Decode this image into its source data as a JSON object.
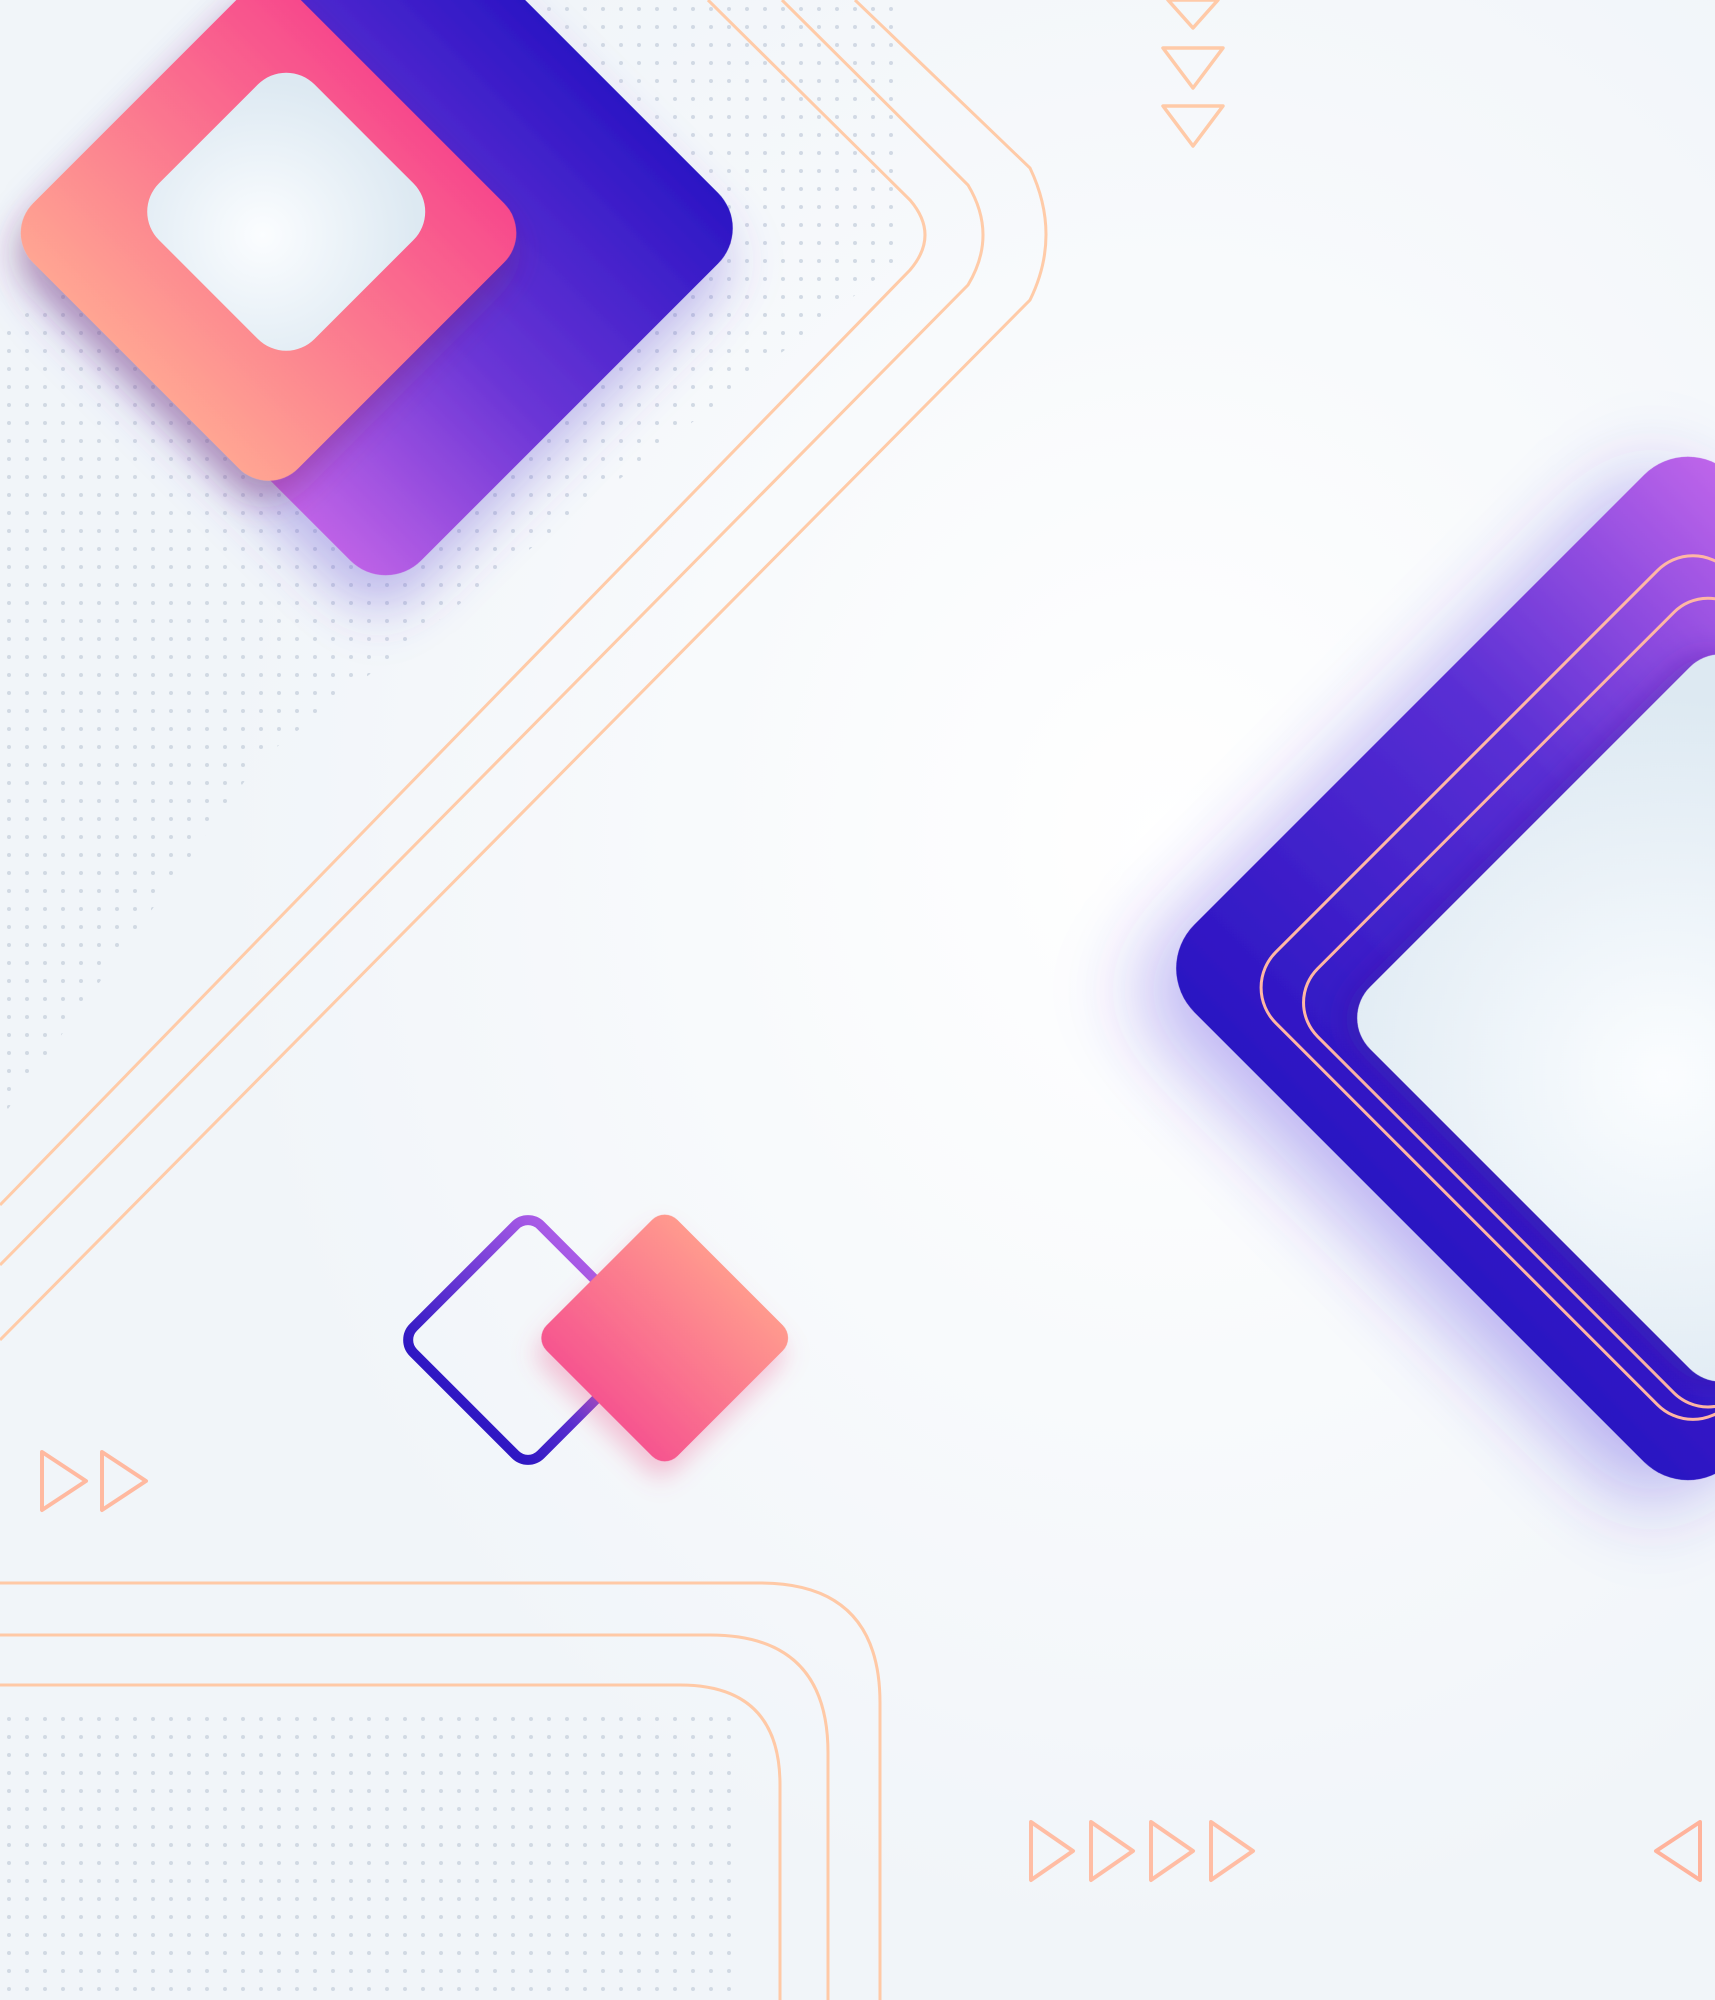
{
  "image": {
    "kind": "abstract geometric background",
    "text_content": "none"
  },
  "palette": {
    "background": "#f3f6f9",
    "background_glow": "#ffffff",
    "deep_blue": "#3417c4",
    "violet": "#7a3fe0",
    "orchid": "#b864e8",
    "pink": "#f65a8f",
    "salmon": "#ffa090",
    "peach_line": "#ffc9a8",
    "inner_panel": "#e8f0f6",
    "dots": "#cfd7e2"
  },
  "icons": [
    "dot-grid-top-left",
    "dot-grid-bottom-left",
    "diamond-large-top-left",
    "diamond-large-right",
    "outline-diamond-small",
    "pink-diamond-small",
    "peach-diagonal-lines",
    "peach-frame-lines-bottom",
    "chevron-down-icon",
    "play-arrow-icon",
    "back-arrow-icon"
  ]
}
